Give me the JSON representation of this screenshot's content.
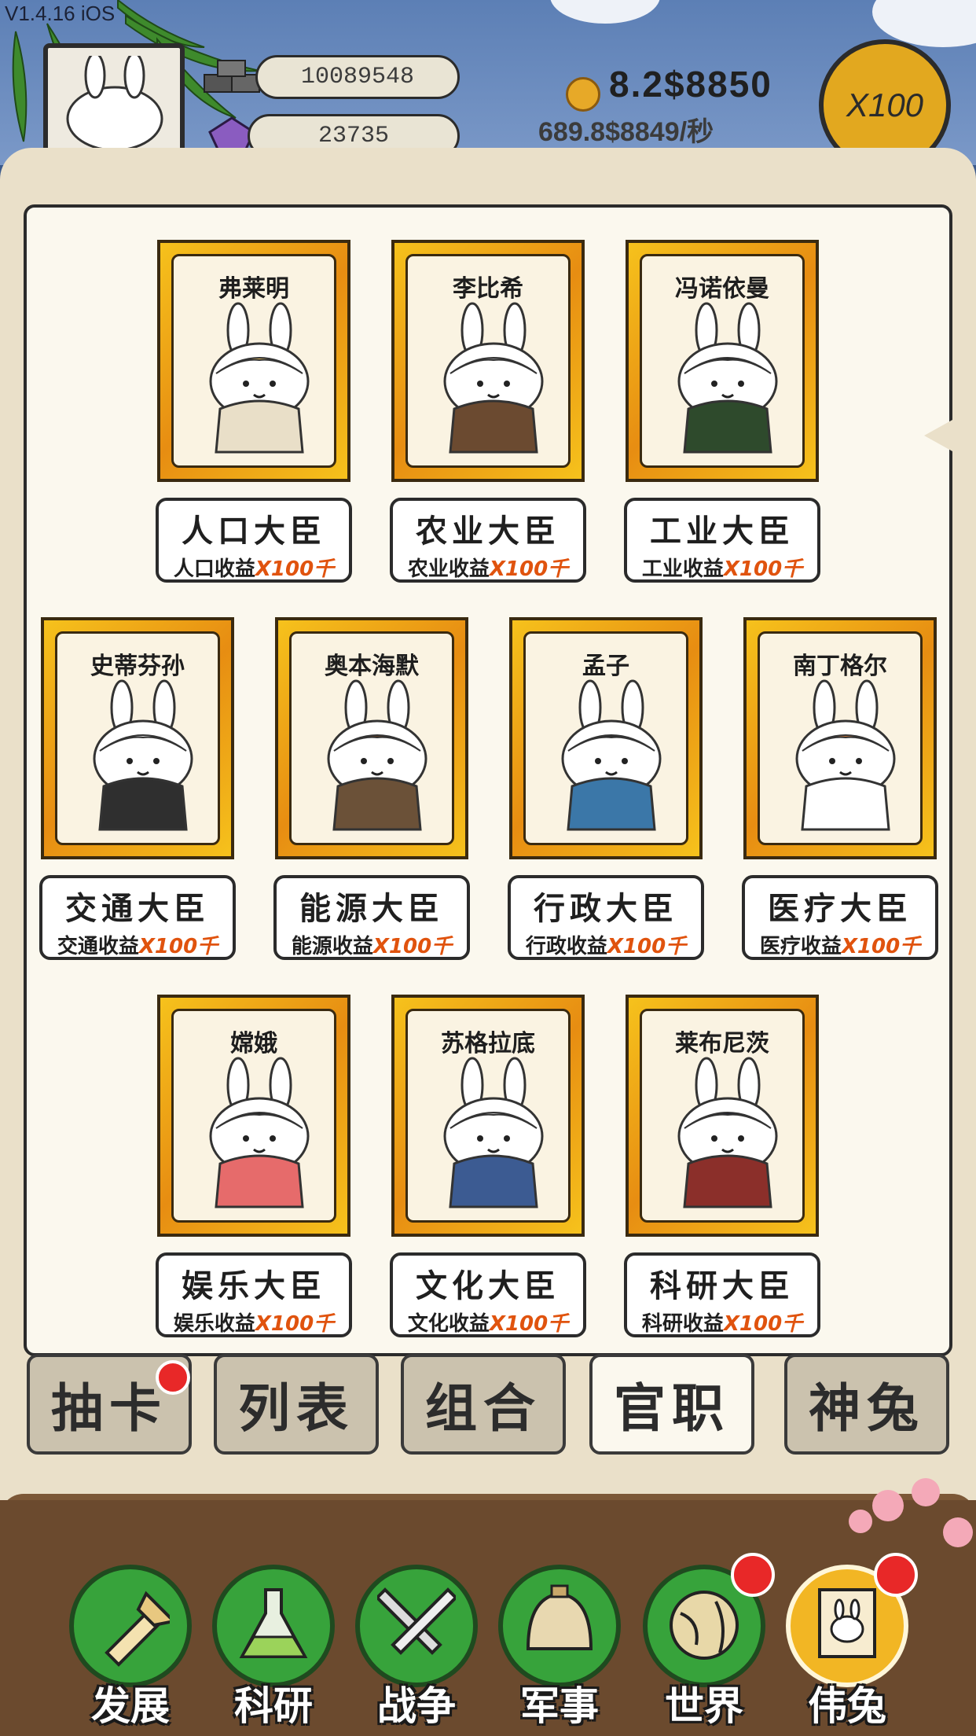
{
  "version": "V1.4.16 iOS",
  "resources": {
    "bricks": "10089548",
    "crystals": "23735",
    "money": "8.2$8850",
    "rate": "689.8$8849/秒",
    "multiplier": "X100"
  },
  "ministers": [
    {
      "name": "弗莱明",
      "title": "人口大臣",
      "bonus": "人口收益",
      "mult": "X100千"
    },
    {
      "name": "李比希",
      "title": "农业大臣",
      "bonus": "农业收益",
      "mult": "X100千"
    },
    {
      "name": "冯诺依曼",
      "title": "工业大臣",
      "bonus": "工业收益",
      "mult": "X100千"
    },
    {
      "name": "史蒂芬孙",
      "title": "交通大臣",
      "bonus": "交通收益",
      "mult": "X100千"
    },
    {
      "name": "奥本海默",
      "title": "能源大臣",
      "bonus": "能源收益",
      "mult": "X100千"
    },
    {
      "name": "孟子",
      "title": "行政大臣",
      "bonus": "行政收益",
      "mult": "X100千"
    },
    {
      "name": "南丁格尔",
      "title": "医疗大臣",
      "bonus": "医疗收益",
      "mult": "X100千"
    },
    {
      "name": "嫦娥",
      "title": "娱乐大臣",
      "bonus": "娱乐收益",
      "mult": "X100千"
    },
    {
      "name": "苏格拉底",
      "title": "文化大臣",
      "bonus": "文化收益",
      "mult": "X100千"
    },
    {
      "name": "莱布尼茨",
      "title": "科研大臣",
      "bonus": "科研收益",
      "mult": "X100千"
    }
  ],
  "tabs": [
    {
      "label": "抽卡",
      "badge": true
    },
    {
      "label": "列表",
      "badge": false
    },
    {
      "label": "组合",
      "badge": false
    },
    {
      "label": "官职",
      "badge": false,
      "active": true
    },
    {
      "label": "神兔",
      "badge": false
    }
  ],
  "nav": [
    {
      "label": "发展",
      "icon": "shovel-icon",
      "badge": false
    },
    {
      "label": "科研",
      "icon": "flask-icon",
      "badge": false
    },
    {
      "label": "战争",
      "icon": "swords-icon",
      "badge": false
    },
    {
      "label": "军事",
      "icon": "helmet-icon",
      "badge": false
    },
    {
      "label": "世界",
      "icon": "globe-icon",
      "badge": true
    },
    {
      "label": "伟兔",
      "icon": "portrait-icon",
      "badge": true,
      "active": true
    }
  ],
  "colors": {
    "card_gold": "#f6c21c",
    "card_orange": "#e78d12",
    "mult_orange": "#e0530e",
    "badge_red": "#e82828",
    "nav_green": "#37a33b",
    "nav_gold": "#f2b624"
  }
}
